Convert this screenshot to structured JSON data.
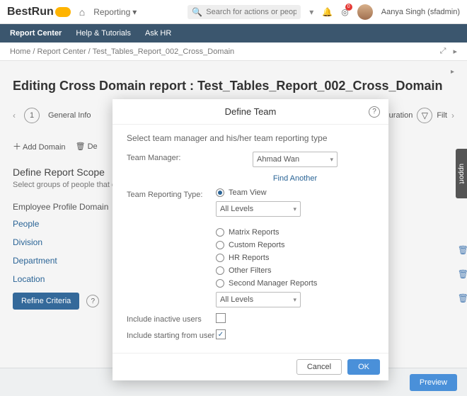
{
  "topbar": {
    "logo_text": "BestRun",
    "menu_reporting": "Reporting",
    "search_placeholder": "Search for actions or people",
    "notif_count": "0",
    "username": "Aanya Singh (sfadmin)"
  },
  "navbar": {
    "items": [
      "Report Center",
      "Help & Tutorials",
      "Ask HR"
    ]
  },
  "breadcrumb": {
    "segments": [
      "Home",
      "Report Center",
      "Test_Tables_Report_002_Cross_Domain"
    ]
  },
  "page": {
    "title": "Editing Cross Domain report : Test_Tables_Report_002_Cross_Domain",
    "wizard_step1_num": "1",
    "wizard_step1_label": "General Info",
    "wizard_right_label": "iguration",
    "wizard_filter_label": "Filt"
  },
  "tools": {
    "add_domain": "Add Domain",
    "delete_prefix": "De"
  },
  "scope": {
    "title": "Define Report Scope",
    "desc": "Select groups of people that c",
    "domain_title": "Employee Profile Domain",
    "links": [
      "People",
      "Division",
      "Department",
      "Location"
    ],
    "refine_btn": "Refine Criteria"
  },
  "footer": {
    "preview": "Preview"
  },
  "support": {
    "label": "upport"
  },
  "modal": {
    "title": "Define Team",
    "instruction": "Select team manager and his/her team reporting type",
    "tm_label": "Team Manager:",
    "tm_value": "Ahmad Wan",
    "find_another": "Find Another",
    "trt_label": "Team Reporting Type:",
    "options": {
      "team_view": "Team View",
      "all_levels": "All Levels",
      "matrix": "Matrix Reports",
      "custom": "Custom Reports",
      "hr": "HR Reports",
      "other": "Other Filters",
      "second_mgr": "Second Manager Reports",
      "all_levels2": "All Levels"
    },
    "include_inactive": "Include inactive users",
    "include_starting": "Include starting from user",
    "cancel": "Cancel",
    "ok": "OK"
  }
}
